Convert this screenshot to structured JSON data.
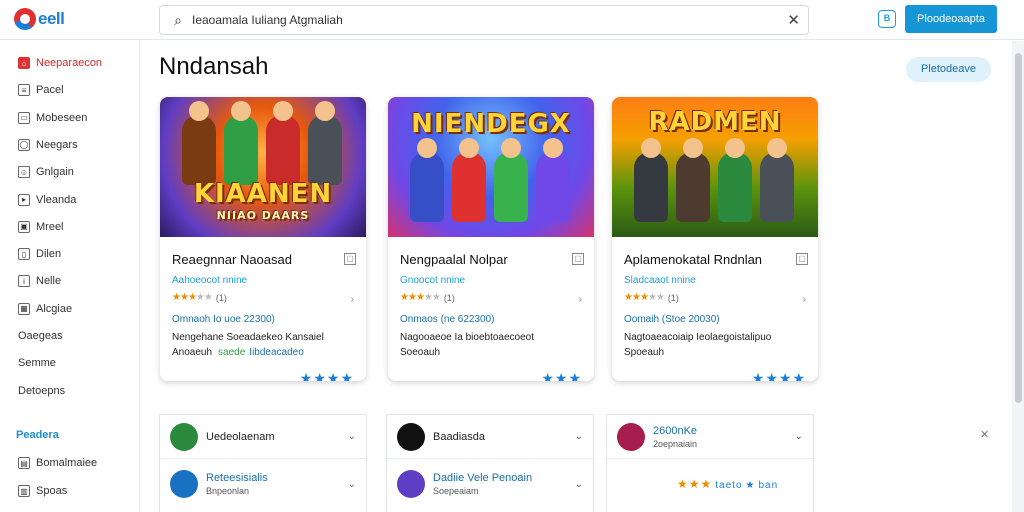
{
  "app": {
    "logo_text": "eell"
  },
  "search": {
    "value": "Ieaoamala Iuliang Atgmaliah",
    "placeholder": "Search"
  },
  "header": {
    "primary_button": "Ploodeoaapta",
    "icon_label": "B"
  },
  "sidebar": {
    "items": [
      {
        "label": "Neeparaecon",
        "icon": "home-icon",
        "active": true
      },
      {
        "label": "Pacel",
        "icon": "list-icon"
      },
      {
        "label": "Mobeseen",
        "icon": "monitor-icon"
      },
      {
        "label": "Neegars",
        "icon": "globe-icon"
      },
      {
        "label": "Gnlgain",
        "icon": "user-icon"
      },
      {
        "label": "Vleanda",
        "icon": "video-icon"
      },
      {
        "label": "Mreel",
        "icon": "image-icon"
      },
      {
        "label": "Dilen",
        "icon": "doc-icon"
      },
      {
        "label": "Nelle",
        "icon": "info-icon"
      },
      {
        "label": "Alcgiae",
        "icon": "grid-icon"
      },
      {
        "label": "Oaegeas",
        "icon": ""
      },
      {
        "label": "Semme",
        "icon": ""
      },
      {
        "label": "Detoepns",
        "icon": ""
      }
    ],
    "section_title": "Peadera",
    "section_items": [
      {
        "label": "Bomalmaiee",
        "icon": "folder-icon"
      },
      {
        "label": "Spoas",
        "icon": "bookmark-icon"
      }
    ]
  },
  "main": {
    "title": "Nndansah",
    "pill_button": "Pletodeave"
  },
  "cards": [
    {
      "art_title": "KIAANEN",
      "art_subtitle": "NIIAO DAARS",
      "name": "Reaegnnar Naoasad",
      "category": "Aahoeocot nnine",
      "rating": 3,
      "rating_count": "(1)",
      "plays": "Omnaoh Io uoe 22300)",
      "desc_line1": "Nengehane Soeadaekeo Kansaiel",
      "desc_prefix": "Anoaeuh",
      "desc_tag": "saede",
      "desc_tag2": "Iibdeacadeo",
      "big_stars": 4
    },
    {
      "art_title": "NIENDEGX",
      "art_subtitle": "",
      "name": "Nengpaalal Nolpar",
      "category": "Gnoocot nnine",
      "rating": 3,
      "rating_count": "(1)",
      "plays": "Onmaos (ne 622300)",
      "desc_line1": "Nagooaeoe Ia bioebtoaecoeot",
      "desc_prefix": "Soeoauh",
      "desc_tag": "",
      "desc_tag2": "",
      "big_stars": 3
    },
    {
      "art_title": "RADMEN",
      "art_subtitle": "",
      "name": "Aplamenokatal Rndnlan",
      "category": "Sladcaaot nnine",
      "rating": 3,
      "rating_count": "(1)",
      "plays": "Oomaih (Stoe 20030)",
      "desc_line1": "Nagtoaeacoiaip Ieolaegoistalipuo",
      "desc_prefix": "Spoeauh",
      "desc_tag": "",
      "desc_tag2": "",
      "big_stars": 4
    }
  ],
  "panels": [
    {
      "rows": [
        {
          "name": "Uedeolaenam",
          "sub": "",
          "avatar_color": "#2b8a3e"
        },
        {
          "name": "Reteesisialis",
          "sub": "Bnpeonlan",
          "avatar_color": "#1971c2"
        }
      ]
    },
    {
      "rows": [
        {
          "name": "Baadiasda",
          "sub": "",
          "avatar_color": "#111111"
        },
        {
          "name": "Dadiie Vele Penoain",
          "sub": "Soepeaiam",
          "avatar_color": "#5f3dc4"
        }
      ]
    },
    {
      "rows": [
        {
          "name": "2600nKe",
          "sub": "2oepnaiain",
          "avatar_color": "#a61e4d"
        },
        {
          "name": "",
          "sub": "",
          "avatar_color": "",
          "stars_text": "taeto",
          "stars_suffix": "ban"
        }
      ]
    }
  ],
  "colors": {
    "accent": "#1596d6",
    "brand_red": "#e03131",
    "star": "#f08c00"
  }
}
